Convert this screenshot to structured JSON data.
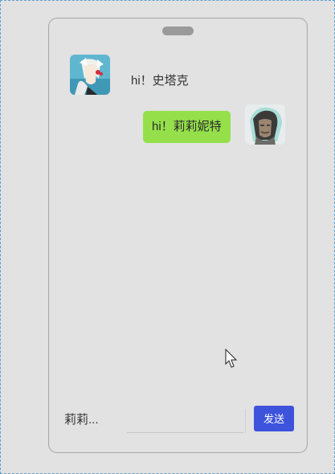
{
  "chat": {
    "messages": [
      {
        "side": "left",
        "text": "hi！史塔克",
        "avatar": "white-haired-girl-avatar"
      },
      {
        "side": "right",
        "text": "hi！莉莉妮特",
        "avatar": "dark-haired-man-avatar"
      }
    ],
    "input": {
      "value": "莉莉..."
    },
    "send_label": "发送"
  },
  "colors": {
    "background": "#e2e2e2",
    "bubble_right": "#95e04a",
    "send_button": "#3d53dc",
    "frame_border": "#5aa0d6"
  },
  "icons": [
    "white-haired-girl-avatar",
    "dark-haired-man-avatar",
    "mouse-cursor-icon"
  ]
}
